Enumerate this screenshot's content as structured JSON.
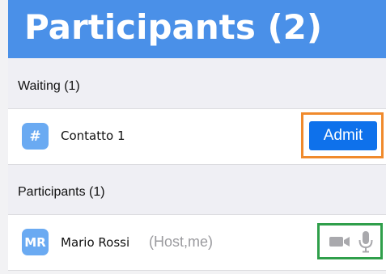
{
  "header": {
    "title": "Participants (2)"
  },
  "waiting": {
    "section_label": "Waiting (1)",
    "items": [
      {
        "avatar": "#",
        "name": "Contatto 1",
        "admit_label": "Admit"
      }
    ]
  },
  "participants": {
    "section_label": "Participants (1)",
    "items": [
      {
        "avatar": "MR",
        "name": "Mario Rossi",
        "role": "(Host,me)",
        "icons": [
          "video-camera-icon",
          "microphone-icon"
        ]
      }
    ]
  },
  "colors": {
    "header_bg": "#4a90e8",
    "avatar_bg": "#6aaaf2",
    "admit_button": "#0e71eb",
    "admit_highlight": "#f08a2c",
    "status_highlight": "#2f9f4a",
    "secondary_text": "#9a9a9e"
  }
}
